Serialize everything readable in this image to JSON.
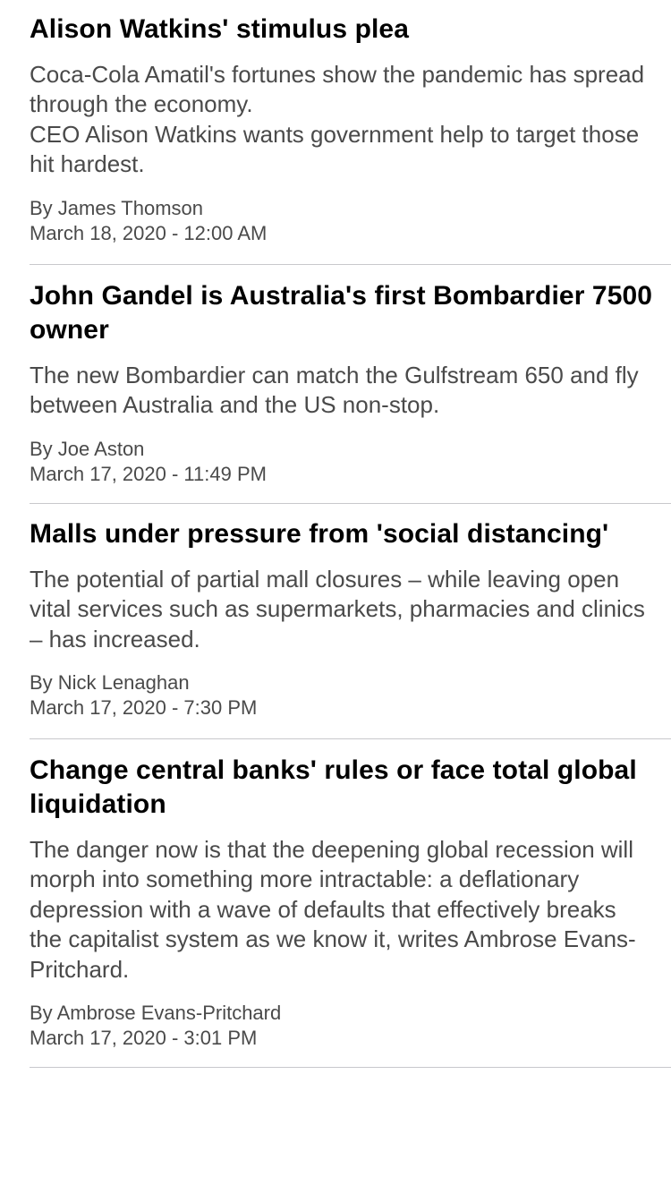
{
  "articles": [
    {
      "headline": "Alison Watkins' stimulus plea",
      "summary": "Coca-Cola Amatil's fortunes show the pandemic has spread through the economy.\nCEO Alison Watkins wants government help to target those hit hardest.",
      "byline": "By James Thomson",
      "date": "March 18, 2020 - 12:00 AM"
    },
    {
      "headline": "John Gandel is Australia's first Bombardier 7500 owner",
      "summary": "The new Bombardier can match the Gulfstream 650 and fly between Australia and the US non-stop.",
      "byline": "By Joe Aston",
      "date": "March 17, 2020 - 11:49 PM"
    },
    {
      "headline": "Malls under pressure from 'social distancing'",
      "summary": "The potential of partial mall closures – while leaving open vital services such as supermarkets, pharmacies and clinics – has increased.",
      "byline": "By Nick Lenaghan",
      "date": "March 17, 2020 - 7:30 PM"
    },
    {
      "headline": "Change central banks' rules or face total global liquidation",
      "summary": "The danger now is that the deepening global recession will morph into something more intractable: a deflationary depression with a wave of defaults that effectively breaks the capitalist system as we know it, writes Ambrose Evans-Pritchard.",
      "byline": "By Ambrose Evans-Pritchard",
      "date": "March 17, 2020 - 3:01 PM"
    }
  ]
}
